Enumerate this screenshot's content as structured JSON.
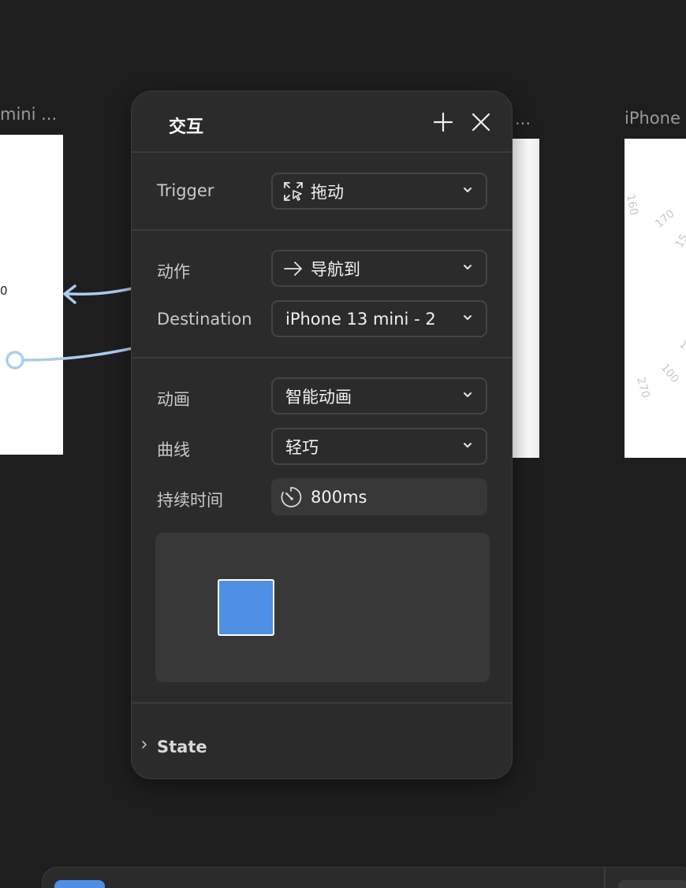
{
  "canvas": {
    "frame_label_left": "mini ...",
    "frame_label_mid": "...",
    "frame_label_right": "iPhone",
    "left_fragment_1": "0",
    "dial_numbers": [
      "160",
      "170",
      "15",
      "100",
      "270",
      "1"
    ]
  },
  "panel": {
    "title": "交互",
    "trigger": {
      "label": "Trigger",
      "value": "拖动",
      "icon": "drag-gesture-icon"
    },
    "action": {
      "label": "动作",
      "value": "导航到",
      "icon": "arrow-right-icon"
    },
    "destination": {
      "label": "Destination",
      "value": "iPhone 13 mini - 2"
    },
    "animation": {
      "label": "动画",
      "value": "智能动画"
    },
    "curve": {
      "label": "曲线",
      "value": "轻巧"
    },
    "duration": {
      "label": "持续时间",
      "value": "800ms",
      "icon": "timer-icon"
    },
    "state": {
      "label": "State"
    }
  },
  "colors": {
    "accent": "#4f8fe6",
    "link": "#a9cdef",
    "panel_bg": "#2b2b2b",
    "canvas_bg": "#1f1e1f"
  }
}
